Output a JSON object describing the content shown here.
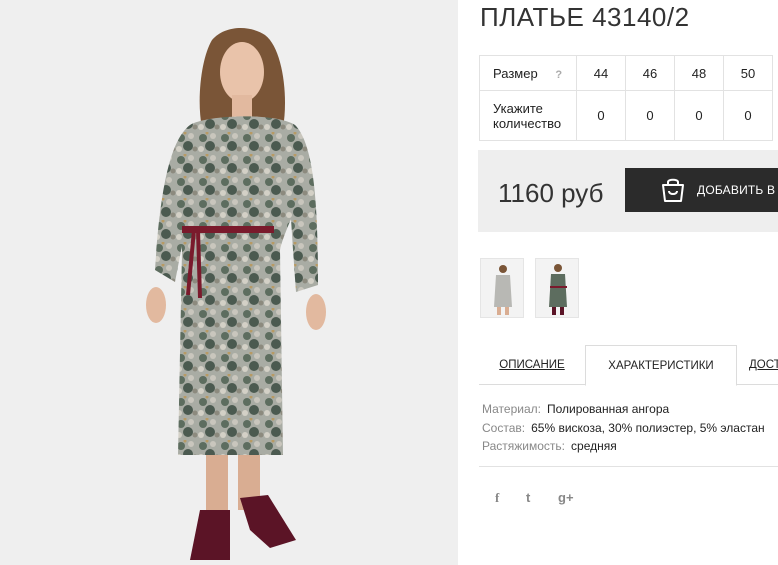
{
  "product": {
    "title": "ПЛАТЬЕ 43140/2",
    "image_alt": "Model wearing a long-sleeve floral print dress with a burgundy cord belt and burgundy lace-up boots"
  },
  "size_table": {
    "size_header": "Размер",
    "help": "?",
    "sizes": [
      "44",
      "46",
      "48",
      "50"
    ],
    "qty_header": "Укажите количество",
    "quantities": [
      "0",
      "0",
      "0",
      "0"
    ]
  },
  "price": {
    "value": "1160 руб",
    "add_button": "ДОБАВИТЬ В ЗАКАЗ",
    "bag_icon": "shopping-bag-icon"
  },
  "thumbnails": [
    {
      "name": "thumbnail-1",
      "selected": false
    },
    {
      "name": "thumbnail-2",
      "selected": true
    }
  ],
  "tabs": [
    {
      "label": "ОПИСАНИЕ",
      "active": false
    },
    {
      "label": "ХАРАКТЕРИСТИКИ",
      "active": true
    },
    {
      "label": "ДОСТАВКА",
      "active": false
    }
  ],
  "specs": [
    {
      "key": "Материал:",
      "value": "Полированная ангора"
    },
    {
      "key": "Состав:",
      "value": "65% вискоза, 30% полиэстер, 5% эластан"
    },
    {
      "key": "Растяжимость:",
      "value": "средняя"
    }
  ],
  "social": [
    {
      "name": "facebook-icon",
      "glyph": "f"
    },
    {
      "name": "twitter-icon",
      "glyph": "t"
    },
    {
      "name": "google-plus-icon",
      "glyph": "g+"
    }
  ],
  "colors": {
    "button_bg": "#2b2b2b",
    "price_bg": "#eeeeee",
    "belt": "#7a1a2c"
  }
}
